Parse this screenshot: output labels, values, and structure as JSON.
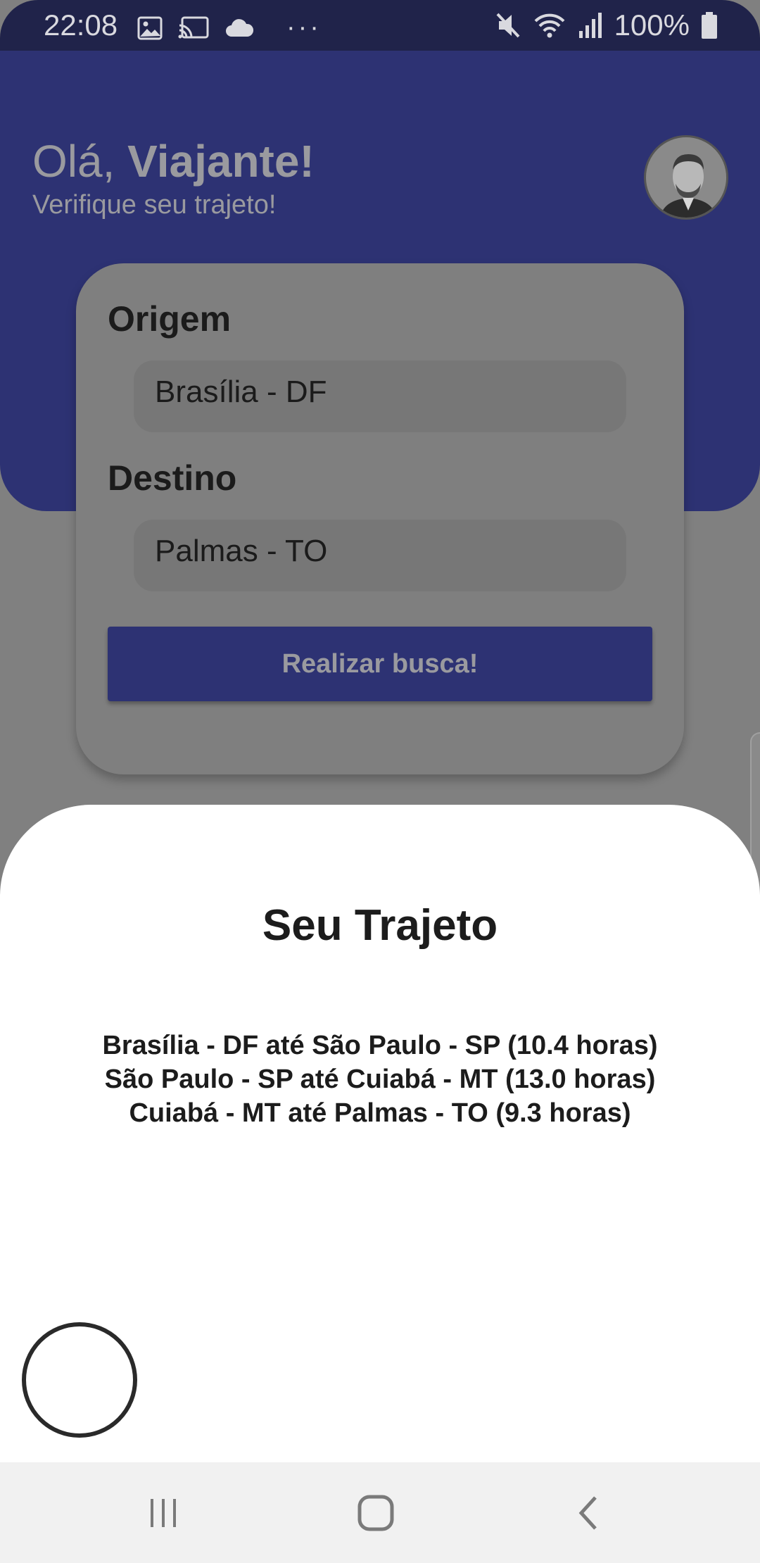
{
  "status_bar": {
    "time": "22:08",
    "battery_percent": "100%",
    "icons_left": [
      "image-icon",
      "cast-icon",
      "cloud-icon",
      "more-icon"
    ],
    "icons_right": [
      "mute-icon",
      "wifi-icon",
      "signal-icon",
      "battery-icon"
    ]
  },
  "header": {
    "greeting_prefix": "Olá, ",
    "greeting_name": "Viajante!",
    "subtitle": "Verifique seu trajeto!"
  },
  "search_card": {
    "origin_label": "Origem",
    "origin_value": "Brasília - DF",
    "destination_label": "Destino",
    "destination_value": "Palmas - TO",
    "search_button_label": "Realizar busca!"
  },
  "route_sheet": {
    "title": "Seu Trajeto",
    "legs": [
      "Brasília - DF até São Paulo - SP (10.4 horas)",
      "São Paulo - SP até Cuiabá - MT (13.0 horas)",
      "Cuiabá - MT até Palmas - TO (9.3 horas)"
    ]
  },
  "colors": {
    "header_bg": "#2d3273",
    "status_bg": "#20234a",
    "scrim": "#808080",
    "sheet_bg": "#ffffff"
  }
}
